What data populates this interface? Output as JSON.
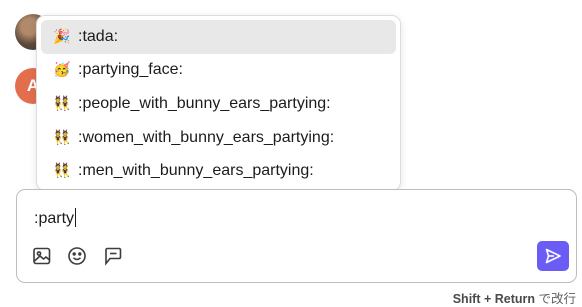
{
  "chat": {
    "peek_text": "",
    "avatar_letter": "A"
  },
  "suggestions": [
    {
      "emoji": "🎉",
      "label": ":tada:",
      "selected": true
    },
    {
      "emoji": "🥳",
      "label": ":partying_face:",
      "selected": false
    },
    {
      "emoji": "👯",
      "label": ":people_with_bunny_ears_partying:",
      "selected": false
    },
    {
      "emoji": "👯",
      "label": ":women_with_bunny_ears_partying:",
      "selected": false
    },
    {
      "emoji": "👯",
      "label": ":men_with_bunny_ears_partying:",
      "selected": false
    }
  ],
  "composer": {
    "value": ":party"
  },
  "toolbar": {
    "image_icon": "image-icon",
    "emoji_icon": "emoji-icon",
    "thread_icon": "thread-icon",
    "send_icon": "send-icon"
  },
  "hint": {
    "keys": "Shift + Return",
    "text": " で改行"
  },
  "colors": {
    "send_button": "#6b5cf6",
    "selected_row": "#e8e8e8"
  }
}
